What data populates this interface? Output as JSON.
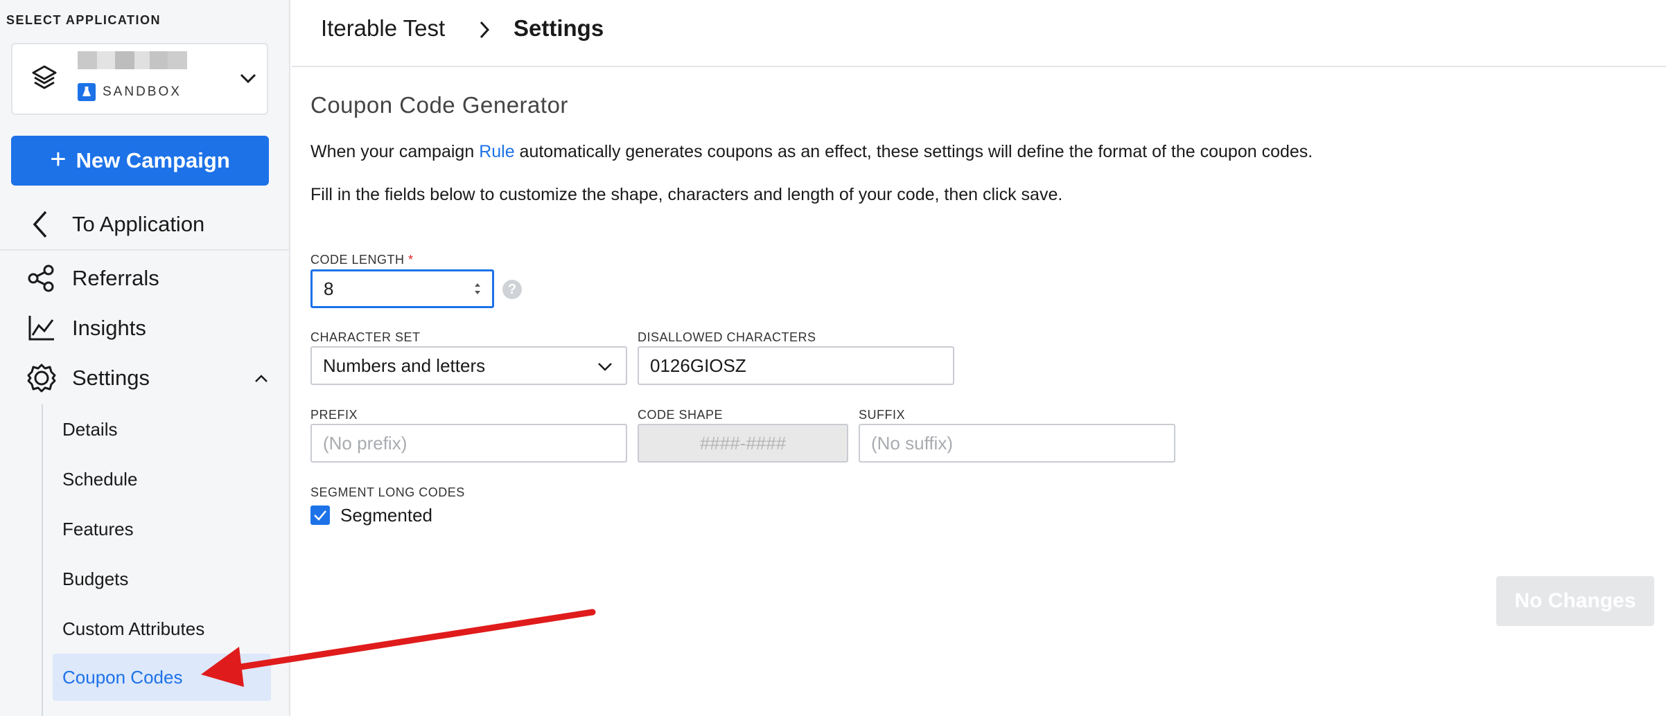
{
  "sidebar": {
    "select_app_label": "SELECT APPLICATION",
    "app": {
      "env_label": "SANDBOX",
      "name_blurred": true,
      "icon": "layers-icon"
    },
    "new_campaign_label": "New Campaign",
    "to_application_label": "To Application",
    "nav": [
      {
        "label": "Referrals",
        "icon": "share-icon"
      },
      {
        "label": "Insights",
        "icon": "chart-line-icon"
      },
      {
        "label": "Settings",
        "icon": "gear-icon",
        "expanded": true
      }
    ],
    "settings_sub": [
      {
        "label": "Details"
      },
      {
        "label": "Schedule"
      },
      {
        "label": "Features"
      },
      {
        "label": "Budgets"
      },
      {
        "label": "Custom Attributes"
      },
      {
        "label": "Coupon Codes",
        "active": true
      }
    ]
  },
  "header": {
    "breadcrumb_parent": "Iterable Test",
    "breadcrumb_current": "Settings"
  },
  "main": {
    "title": "Coupon Code Generator",
    "intro_before_link": "When your campaign ",
    "intro_link": "Rule",
    "intro_after_link": " automatically generates coupons as an effect, these settings will define the format of the coupon codes.",
    "intro_2": "Fill in the fields below to customize the shape, characters and length of your code, then click save.",
    "code_length": {
      "label": "CODE LENGTH",
      "required_mark": "*",
      "value": "8"
    },
    "character_set": {
      "label": "CHARACTER SET",
      "value": "Numbers and letters"
    },
    "disallowed": {
      "label": "DISALLOWED CHARACTERS",
      "value": "0126GIOSZ"
    },
    "prefix": {
      "label": "PREFIX",
      "placeholder": "(No prefix)"
    },
    "code_shape": {
      "label": "CODE SHAPE",
      "value": "####-####"
    },
    "suffix": {
      "label": "SUFFIX",
      "placeholder": "(No suffix)"
    },
    "segment": {
      "label": "SEGMENT LONG CODES",
      "checkbox_label": "Segmented",
      "checked": true
    },
    "save_button_label": "No Changes"
  },
  "colors": {
    "accent": "#1d72e8",
    "annotation_arrow": "#e01b1b"
  }
}
